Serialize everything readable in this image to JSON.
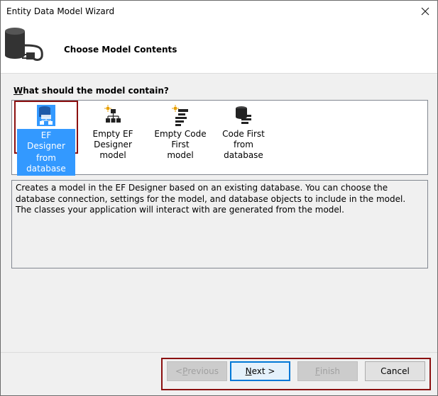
{
  "window": {
    "title": "Entity Data Model Wizard"
  },
  "header": {
    "title": "Choose Model Contents",
    "icon": "database-connection-icon"
  },
  "question": {
    "label": "What should the model contain?",
    "mnemonic": "W",
    "rest": "hat should the model contain?"
  },
  "choices": [
    {
      "line1": "EF Designer",
      "line2": "from database",
      "icon": "ef-designer-database-icon",
      "selected": true
    },
    {
      "line1": "Empty EF",
      "line2": "Designer model",
      "icon": "empty-ef-designer-icon",
      "selected": false
    },
    {
      "line1": "Empty Code First",
      "line2": "model",
      "icon": "empty-code-first-icon",
      "selected": false
    },
    {
      "line1": "Code First from",
      "line2": "database",
      "icon": "code-first-database-icon",
      "selected": false
    }
  ],
  "description": "Creates a model in the EF Designer based on an existing database. You can choose the database connection, settings for the model, and database objects to include in the model. The classes your application will interact with are generated from the model.",
  "buttons": {
    "previous": {
      "mnemonic": "P",
      "before": "< ",
      "after": "revious",
      "enabled": false
    },
    "next": {
      "mnemonic": "N",
      "before": "",
      "after": "ext >",
      "enabled": true
    },
    "finish": {
      "mnemonic": "F",
      "before": "",
      "after": "inish",
      "enabled": false
    },
    "cancel": {
      "label": "Cancel",
      "enabled": true
    }
  },
  "colors": {
    "selection": "#3399ff",
    "highlight_border": "#8b1010",
    "default_button": "#0078d7"
  }
}
